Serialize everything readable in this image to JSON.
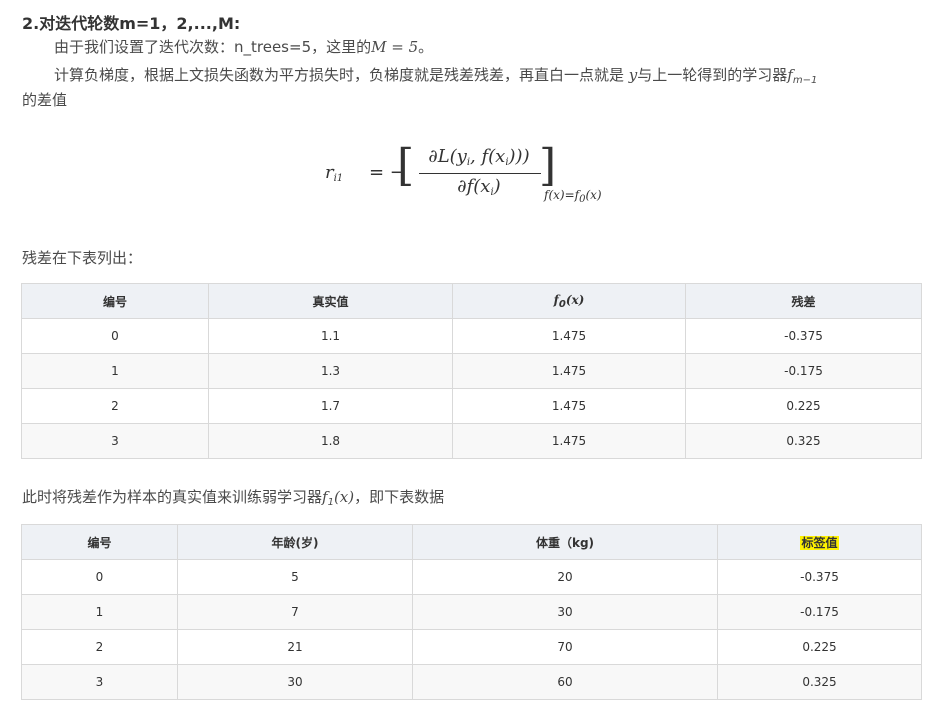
{
  "heading": "2.对迭代轮数m=1，2,...,M:",
  "p1": {
    "prefix": "由于我们设置了迭代次数：n_trees=5，这里的",
    "math": "M = 5",
    "suffix": "。"
  },
  "p2": {
    "prefix": "计算负梯度，根据上文损失函数为平方损失时，负梯度就是残差残差，再直白一点就是 ",
    "var_y": "y",
    "middle": "与上一轮得到的学习器",
    "var_f": "f",
    "sub_f": "m−1",
    "line2": "的差值"
  },
  "formula": {
    "lhs": "r",
    "lhs_sub": "i1",
    "eq": "= −",
    "numerator": "∂L(y",
    "numerator_sub": "i",
    "numerator_mid": ", f(x",
    "numerator_sub2": "i",
    "numerator_end": ")))",
    "denominator": "∂f(x",
    "denominator_sub": "i",
    "denominator_end": ")",
    "condition": "f(x)=f",
    "condition_sub": "0",
    "condition_end": "(x)"
  },
  "p3": "残差在下表列出：",
  "table1": {
    "headers": [
      "编号",
      "真实值",
      "f",
      "残差"
    ],
    "header_f_sub": "0",
    "header_f_end": "(x)",
    "rows": [
      [
        "0",
        "1.1",
        "1.475",
        "-0.375"
      ],
      [
        "1",
        "1.3",
        "1.475",
        "-0.175"
      ],
      [
        "2",
        "1.7",
        "1.475",
        "0.225"
      ],
      [
        "3",
        "1.8",
        "1.475",
        "0.325"
      ]
    ]
  },
  "p4": {
    "prefix": "此时将残差作为样本的真实值来训练弱学习器",
    "var_f": "f",
    "sub": "1",
    "arg": "(x)",
    "suffix": "，即下表数据"
  },
  "table2": {
    "headers": [
      "编号",
      "年龄(岁)",
      "体重（kg)",
      "标签值"
    ],
    "rows": [
      [
        "0",
        "5",
        "20",
        "-0.375"
      ],
      [
        "1",
        "7",
        "30",
        "-0.175"
      ],
      [
        "2",
        "21",
        "70",
        "0.225"
      ],
      [
        "3",
        "30",
        "60",
        "0.325"
      ]
    ]
  },
  "colors": {
    "highlight": "#fff200",
    "header_bg": "#eef1f5",
    "border": "#d9d9d9"
  }
}
